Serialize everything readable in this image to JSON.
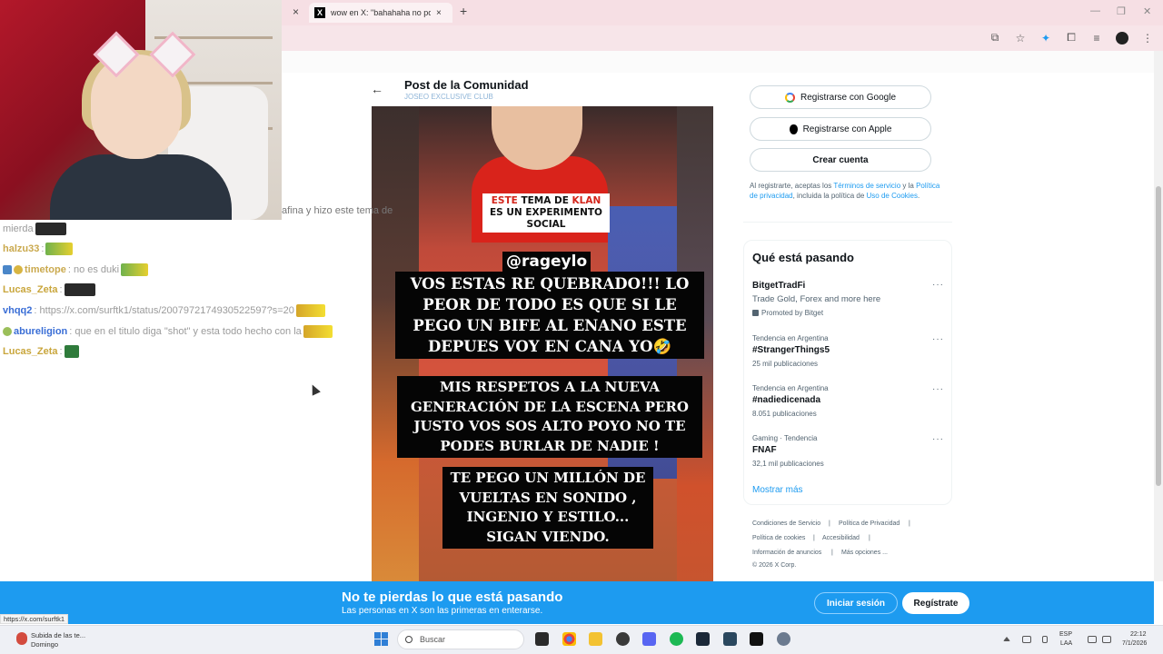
{
  "browser": {
    "tab_title": "wow en X: \"bahahaha no pode:",
    "tab_close": "×",
    "new_tab": "+",
    "favicon": "X",
    "minimize": "—",
    "maximize": "❐",
    "close": "✕",
    "status_url": "https://x.com/surftk1"
  },
  "chat": {
    "caption_overlay": "afina y hizo este tema de",
    "lines": [
      {
        "user": "mierda",
        "msg": ""
      },
      {
        "user": "halzu33",
        "msg": ":"
      },
      {
        "user": "timetope",
        "msg": ": no es duki"
      },
      {
        "user": "Lucas_Zeta",
        "msg": ":"
      },
      {
        "user": "vhqq2",
        "msg": ": https://x.com/surftk1/status/2007972174930522597?s=20"
      },
      {
        "user": "abureligion",
        "msg": ": que en el titulo diga \"shot\" y esta todo hecho con la"
      },
      {
        "user": "Lucas_Zeta",
        "msg": ":"
      }
    ]
  },
  "post": {
    "back_icon": "←",
    "title": "Post de la Comunidad",
    "community": "JOSEO EXCLUSIVE CLUB",
    "media": {
      "label_red_1": "ESTE ",
      "label_black_1": "TEMA DE ",
      "label_red_2": "KLAN",
      "label_black_2": " ES UN EXPERIMENTO SOCIAL",
      "handle": "@rageylo",
      "block1": "VOS ESTAS RE QUEBRADO!!! LO PEOR DE TODO ES QUE SI LE PEGO UN BIFE AL ENANO ESTE DEPUES VOY EN CANA YO🤣",
      "block2": "MIS RESPETOS A LA NUEVA GENERACIÓN DE LA ESCENA PERO JUSTO VOS SOS ALTO POYO NO TE PODES BURLAR DE NADIE !",
      "block3": "TE PEGO UN MILLÓN DE VUELTAS EN SONIDO , INGENIO Y ESTILO... SIGAN VIENDO."
    }
  },
  "sidebar": {
    "google_btn": "Registrarse con Google",
    "apple_btn": "Registrarse con Apple",
    "create_btn": "Crear cuenta",
    "terms_prefix": "Al registrarte, aceptas los ",
    "terms_link": "Términos de servicio",
    "terms_mid": " y la ",
    "privacy_link": "Política de privacidad",
    "terms_mid2": ", incluida la política de ",
    "cookies_link": "Uso de Cookies",
    "terms_end": ".",
    "trends_title": "Qué está pasando",
    "trends": [
      {
        "context": "",
        "name": "BitgetTradFi",
        "desc": "Trade Gold, Forex and more here",
        "count": "Promoted by Bitget"
      },
      {
        "context": "Tendencia en Argentina",
        "name": "#StrangerThings5",
        "desc": "",
        "count": "25 mil publicaciones"
      },
      {
        "context": "Tendencia en Argentina",
        "name": "#nadiedicenada",
        "desc": "",
        "count": "8.051 publicaciones"
      },
      {
        "context": "Gaming · Tendencia",
        "name": "FNAF",
        "desc": "",
        "count": "32,1 mil publicaciones"
      }
    ],
    "more_glyph": "···",
    "show_more": "Mostrar más",
    "footer": {
      "tos": "Condiciones de Servicio",
      "privacy": "Política de Privacidad",
      "cookies": "Política de cookies",
      "access": "Accesibilidad",
      "ads": "Información de anuncios",
      "more": "Más opciones ...",
      "copy": "© 2026 X Corp.",
      "sep": "|"
    }
  },
  "banner": {
    "title": "No te pierdas lo que está pasando",
    "subtitle": "Las personas en X son las primeras en enterarse.",
    "login": "Iniciar sesión",
    "signup": "Regístrate"
  },
  "taskbar": {
    "weather_1": "Subida de las te...",
    "weather_2": "Domingo",
    "search": "Buscar",
    "lang_1": "ESP",
    "lang_2": "LAA",
    "time": "22:12",
    "date": "7/1/2026"
  },
  "colors": {
    "x_blue": "#1d9bf0",
    "chrome_pink": "#f6dfe4"
  }
}
